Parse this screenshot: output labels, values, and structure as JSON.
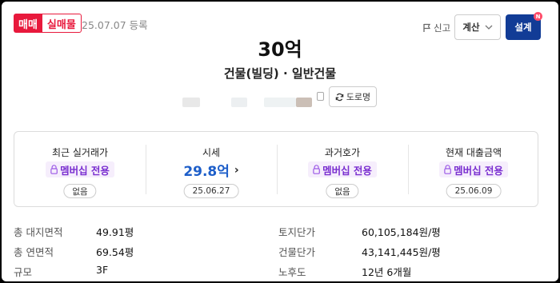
{
  "header": {
    "badge_trade": "매매",
    "badge_real": "실매물",
    "registered": "25.07.07 등록",
    "report_label": "신고",
    "calc_label": "계산",
    "explain_label": "설계",
    "new_badge": "N"
  },
  "listing": {
    "price": "30억",
    "building_type": "건물(빌딩) · 일반건물",
    "road_button": "도로명"
  },
  "summary": {
    "recent": {
      "label": "최근 실거래가",
      "member": "멤버십 전용",
      "pill": "없음"
    },
    "market": {
      "label": "시세",
      "value": "29.8억",
      "arrow": "›",
      "pill": "25.06.27"
    },
    "past": {
      "label": "과거호가",
      "member": "멤버십 전용",
      "pill": "없음"
    },
    "loan": {
      "label": "현재 대출금액",
      "member": "멤버십 전용",
      "pill": "25.06.09"
    }
  },
  "details": {
    "land_area_label": "총 대지면적",
    "land_area": "49.91평",
    "floor_area_label": "총 연면적",
    "floor_area": "69.54평",
    "scale_label": "규모",
    "scale": "3F",
    "land_price_label": "토지단가",
    "land_price": "60,105,184원/평",
    "bld_price_label": "건물단가",
    "bld_price": "43,141,445원/평",
    "age_label": "노후도",
    "age": "12년 6개월"
  },
  "colors": {
    "accent_red": "#e8193c",
    "navy": "#123c96",
    "member_purple": "#7a2fd0",
    "value_blue": "#1d5ec9"
  },
  "icons": [
    "flag-icon",
    "chevron-down-icon",
    "refresh-icon",
    "lock-icon",
    "copy-icon"
  ]
}
